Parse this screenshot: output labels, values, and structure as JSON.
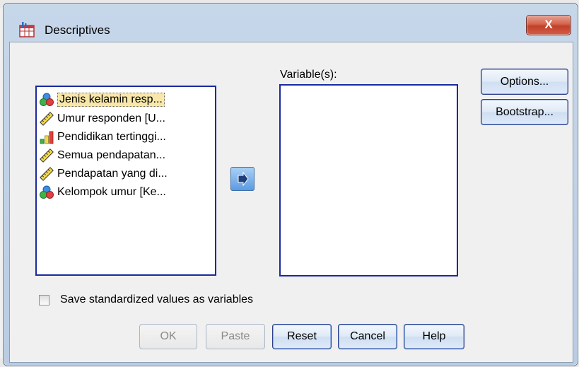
{
  "window": {
    "title": "Descriptives",
    "close_label": "X"
  },
  "source_list": {
    "items": [
      {
        "label": "Jenis kelamin resp...",
        "icon": "nominal-icon",
        "selected": true
      },
      {
        "label": "Umur responden [U...",
        "icon": "scale-ruler-icon",
        "selected": false
      },
      {
        "label": "Pendidikan tertinggi...",
        "icon": "ordinal-bar-icon",
        "selected": false
      },
      {
        "label": "Semua pendapatan...",
        "icon": "scale-ruler-icon",
        "selected": false
      },
      {
        "label": "Pendapatan yang di...",
        "icon": "scale-ruler-icon",
        "selected": false
      },
      {
        "label": "Kelompok umur [Ke...",
        "icon": "nominal-icon",
        "selected": false
      }
    ]
  },
  "variables": {
    "label": "Variable(s):"
  },
  "side_buttons": {
    "options": "Options...",
    "bootstrap": "Bootstrap..."
  },
  "save_option": {
    "label": "Save standardized values as variables",
    "checked": false
  },
  "bottom_buttons": {
    "ok": "OK",
    "paste": "Paste",
    "reset": "Reset",
    "cancel": "Cancel",
    "help": "Help"
  },
  "colors": {
    "list_border": "#1a2aa0",
    "selected_item_bg": "#f8e7a8",
    "close_button": "#c9452e",
    "arrow_button": "#5b9be2"
  }
}
